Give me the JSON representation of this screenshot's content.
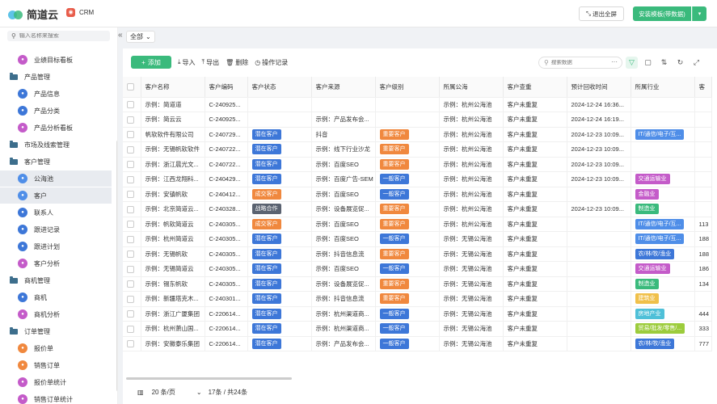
{
  "app": {
    "logo_text": "简道云",
    "tab_label": "CRM",
    "tab_icon": "crm-icon",
    "exit_fullscreen": "退出全屏",
    "install_template": "安装模板(带数据)"
  },
  "sidebar": {
    "search_placeholder": "输入名称来搜索",
    "items": [
      {
        "kind": "child",
        "label": "业绩目标看板",
        "icon": "dashboard-icon",
        "color": "#c45bc9",
        "active": false
      },
      {
        "kind": "group",
        "label": "产品管理",
        "active": false
      },
      {
        "kind": "child",
        "label": "产品信息",
        "icon": "form-icon",
        "color": "#3d77d8",
        "active": false
      },
      {
        "kind": "child",
        "label": "产品分类",
        "icon": "form-icon",
        "color": "#3d77d8",
        "active": false
      },
      {
        "kind": "child",
        "label": "产品分析看板",
        "icon": "dashboard-icon",
        "color": "#c45bc9",
        "active": false
      },
      {
        "kind": "group",
        "label": "市场及线索管理",
        "active": false
      },
      {
        "kind": "group",
        "label": "客户管理",
        "active": false
      },
      {
        "kind": "child",
        "label": "公海池",
        "icon": "user-icon",
        "color": "#4f8ee8",
        "active": true
      },
      {
        "kind": "child",
        "label": "客户",
        "icon": "user-icon",
        "color": "#4f8ee8",
        "active": true
      },
      {
        "kind": "child",
        "label": "联系人",
        "icon": "form-icon",
        "color": "#3d77d8",
        "active": false
      },
      {
        "kind": "child",
        "label": "跟进记录",
        "icon": "form-icon",
        "color": "#3d77d8",
        "active": false
      },
      {
        "kind": "child",
        "label": "跟进计划",
        "icon": "form-icon",
        "color": "#3d77d8",
        "active": false
      },
      {
        "kind": "child",
        "label": "客户分析",
        "icon": "dashboard-icon",
        "color": "#c45bc9",
        "active": false
      },
      {
        "kind": "group",
        "label": "商机管理",
        "active": false
      },
      {
        "kind": "child",
        "label": "商机",
        "icon": "target-icon",
        "color": "#3d77d8",
        "active": false
      },
      {
        "kind": "child",
        "label": "商机分析",
        "icon": "dashboard-icon",
        "color": "#c45bc9",
        "active": false
      },
      {
        "kind": "group",
        "label": "订单管理",
        "active": false
      },
      {
        "kind": "child",
        "label": "报价单",
        "icon": "flow-icon",
        "color": "#f0883e",
        "active": false
      },
      {
        "kind": "child",
        "label": "销售订单",
        "icon": "flow-icon",
        "color": "#f0883e",
        "active": false
      },
      {
        "kind": "child",
        "label": "报价单统计",
        "icon": "dashboard-icon",
        "color": "#c45bc9",
        "active": false
      },
      {
        "kind": "child",
        "label": "销售订单统计",
        "icon": "dashboard-icon",
        "color": "#c45bc9",
        "active": false
      }
    ]
  },
  "filter": {
    "label": "全部"
  },
  "toolbar": {
    "add": "添加",
    "import": "导入",
    "export": "导出",
    "delete": "删除",
    "log": "操作记录",
    "search_placeholder": "搜索数据"
  },
  "table": {
    "columns": [
      "客户名称",
      "客户编码",
      "客户状态",
      "客户来源",
      "客户级别",
      "所属公海",
      "客户查重",
      "预计回收时间",
      "所属行业",
      "客"
    ],
    "rows": [
      {
        "name": "示例：简道道",
        "code": "C-240925...",
        "status": "",
        "source": "",
        "level": "",
        "pool": "示例：杭州公海池",
        "dup": "客户未重复",
        "time": "2024-12-24 16:36...",
        "industry": "",
        "extra": ""
      },
      {
        "name": "示例：简云云",
        "code": "C-240925...",
        "status": "",
        "source": "示例：产品发布会...",
        "level": "",
        "pool": "示例：杭州公海池",
        "dup": "客户未重复",
        "time": "2024-12-24 16:19...",
        "industry": "",
        "extra": ""
      },
      {
        "name": "帆软软件有限公司",
        "code": "C-240729...",
        "status": "潜在客户",
        "source": "抖音",
        "level": "重要客户",
        "pool": "示例：杭州公海池",
        "dup": "客户未重复",
        "time": "2024-12-23 10:09...",
        "industry": "IT/通信/电子/互...",
        "extra": ""
      },
      {
        "name": "示例：无锡帆软软件",
        "code": "C-240722...",
        "status": "潜在客户",
        "source": "示例：线下行业沙龙",
        "level": "重要客户",
        "pool": "示例：杭州公海池",
        "dup": "客户未重复",
        "time": "2024-12-23 10:09...",
        "industry": "",
        "extra": ""
      },
      {
        "name": "示例：浙江晨光文...",
        "code": "C-240722...",
        "status": "潜在客户",
        "source": "示例：百度SEO",
        "level": "重要客户",
        "pool": "示例：杭州公海池",
        "dup": "客户未重复",
        "time": "2024-12-23 10:09...",
        "industry": "",
        "extra": ""
      },
      {
        "name": "示例：江西龙翔科...",
        "code": "C-240429...",
        "status": "潜在客户",
        "source": "示例：百度广告-SEM",
        "level": "一般客户",
        "pool": "示例：杭州公海池",
        "dup": "客户未重复",
        "time": "2024-12-23 10:09...",
        "industry": "交通运输业",
        "extra": ""
      },
      {
        "name": "示例：安镇帆软",
        "code": "C-240412...",
        "status": "成交客户",
        "source": "示例：百度SEO",
        "level": "一般客户",
        "pool": "示例：杭州公海池",
        "dup": "客户未重复",
        "time": "",
        "industry": "金融业",
        "extra": ""
      },
      {
        "name": "示例：北京简道云...",
        "code": "C-240328...",
        "status": "战略合作",
        "source": "示例：设备展览促...",
        "level": "重要客户",
        "pool": "示例：杭州公海池",
        "dup": "客户未重复",
        "time": "2024-12-23 10:09...",
        "industry": "制造业",
        "extra": ""
      },
      {
        "name": "示例：帆软简道云",
        "code": "C-240305...",
        "status": "成交客户",
        "source": "示例：百度SEO",
        "level": "重要客户",
        "pool": "示例：杭州公海池",
        "dup": "客户未重复",
        "time": "",
        "industry": "IT/通信/电子/互...",
        "extra": "113"
      },
      {
        "name": "示例：杭州简道云",
        "code": "C-240305...",
        "status": "潜在客户",
        "source": "示例：百度SEO",
        "level": "一般客户",
        "pool": "示例：无锡公海池",
        "dup": "客户未重复",
        "time": "",
        "industry": "IT/通信/电子/互...",
        "extra": "188"
      },
      {
        "name": "示例：无锡帆软",
        "code": "C-240305...",
        "status": "潜在客户",
        "source": "示例：抖音信息流",
        "level": "重要客户",
        "pool": "示例：无锡公海池",
        "dup": "客户未重复",
        "time": "",
        "industry": "农/林/牧/渔业",
        "extra": "188"
      },
      {
        "name": "示例：无锡简道云",
        "code": "C-240305...",
        "status": "潜在客户",
        "source": "示例：百度SEO",
        "level": "一般客户",
        "pool": "示例：无锡公海池",
        "dup": "客户未重复",
        "time": "",
        "industry": "交通运输业",
        "extra": "186"
      },
      {
        "name": "示例：锡东帆软",
        "code": "C-240305...",
        "status": "潜在客户",
        "source": "示例：设备展览促...",
        "level": "重要客户",
        "pool": "示例：无锡公海池",
        "dup": "客户未重复",
        "time": "",
        "industry": "制造业",
        "extra": "134"
      },
      {
        "name": "示例：新疆塔克木...",
        "code": "C-240301...",
        "status": "潜在客户",
        "source": "示例：抖音信息流",
        "level": "重要客户",
        "pool": "示例：无锡公海池",
        "dup": "客户未重复",
        "time": "",
        "industry": "建筑业",
        "extra": ""
      },
      {
        "name": "示例：浙江广厦集团",
        "code": "C-220614...",
        "status": "潜在客户",
        "source": "示例：杭州渠道商...",
        "level": "一般客户",
        "pool": "示例：无锡公海池",
        "dup": "客户未重复",
        "time": "",
        "industry": "房地产业",
        "extra": "444"
      },
      {
        "name": "示例：杭州萧山国...",
        "code": "C-220614...",
        "status": "潜在客户",
        "source": "示例：杭州渠道商...",
        "level": "一般客户",
        "pool": "示例：无锡公海池",
        "dup": "客户未重复",
        "time": "",
        "industry": "贸易/批发/零售/...",
        "extra": "333"
      },
      {
        "name": "示例：安徽泰乐集团",
        "code": "C-220614...",
        "status": "潜在客户",
        "source": "示例：产品发布会...",
        "level": "一般客户",
        "pool": "示例：无锡公海池",
        "dup": "客户未重复",
        "time": "",
        "industry": "农/林/牧/渔业",
        "extra": "777"
      }
    ]
  },
  "tag_colors": {
    "潜在客户": "#3d77d8",
    "成交客户": "#f0883e",
    "战略合作": "#5a6270",
    "重要客户": "#f0883e",
    "一般客户": "#3d77d8",
    "IT/通信/电子/互...": "#4f8ee8",
    "交通运输业": "#c45bc9",
    "金融业": "#c45bc9",
    "制造业": "#3aba7c",
    "农/林/牧/渔业": "#3d77d8",
    "建筑业": "#f0c04a",
    "房地产业": "#4fc0d8",
    "贸易/批发/零售/...": "#9ccc3c"
  },
  "pager": {
    "page_size": "20 条/页",
    "summary": "17条 / 共24条"
  }
}
